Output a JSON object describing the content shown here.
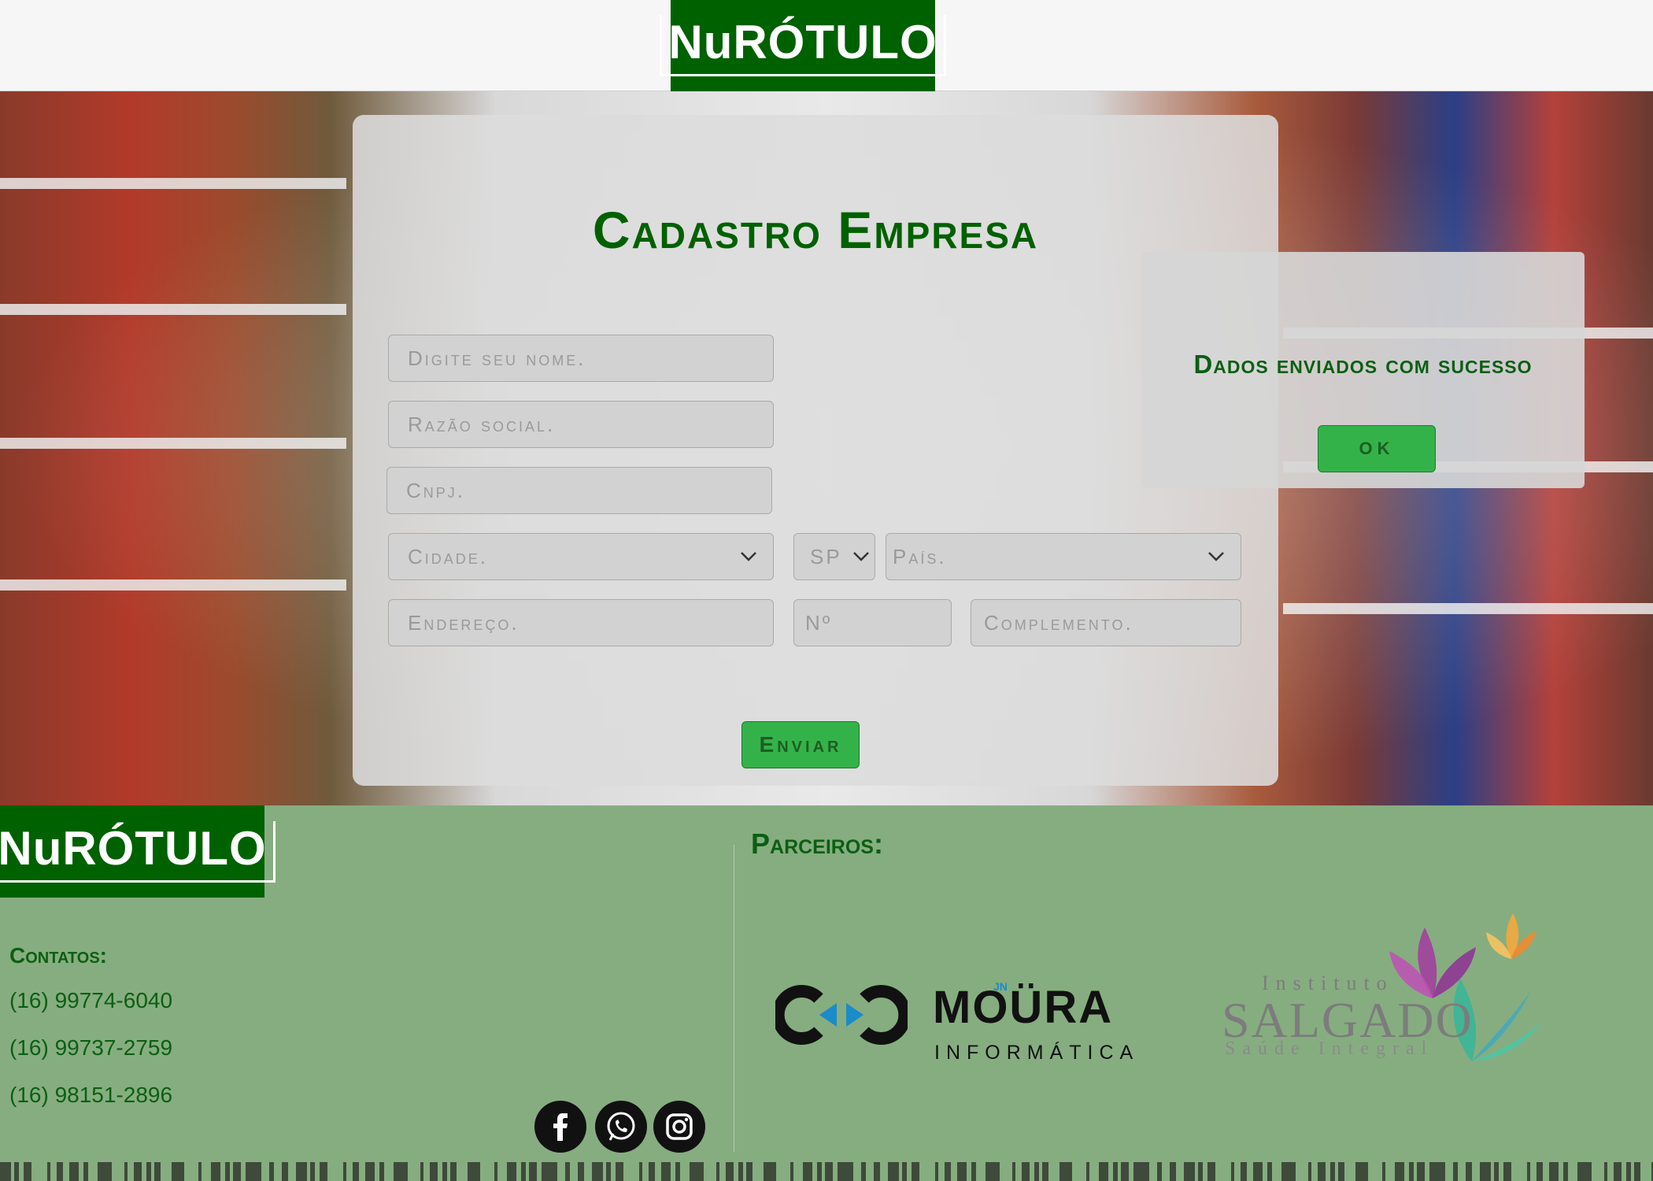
{
  "header": {
    "logo_text": "NuRÓTULO"
  },
  "form": {
    "title": "Cadastro Empresa",
    "fields": {
      "nome": "Digite seu nome.",
      "razao": "Razão social.",
      "cnpj": "Cnpj.",
      "cidade": "Cidade.",
      "uf": "SP",
      "pais": "País.",
      "endereco": "Endereço.",
      "numero": "Nº",
      "complemento": "Complemento."
    },
    "submit_label": "Enviar"
  },
  "toast": {
    "message": "Dados enviados com sucesso",
    "ok_label": "OK"
  },
  "footer": {
    "logo_text": "NuRÓTULO",
    "contacts_title": "Contatos:",
    "phones": [
      "(16) 99774-6040",
      "(16) 99737-2759",
      "(16) 98151-2896"
    ],
    "partners_title": "Parceiros:",
    "partners": {
      "moura": {
        "name": "MOÜRA",
        "jn": "JN",
        "sub": "INFORMÁTICA"
      },
      "salgado": {
        "line1": "Instituto",
        "line2": "SALGADO",
        "line3": "Saúde Integral"
      }
    },
    "social_icons": [
      "facebook-icon",
      "whatsapp-icon",
      "instagram-icon"
    ]
  },
  "colors": {
    "brand_green": "#006100",
    "button_green": "#34b24a",
    "footer_bg": "#86ad80",
    "title_green": "#006100"
  }
}
